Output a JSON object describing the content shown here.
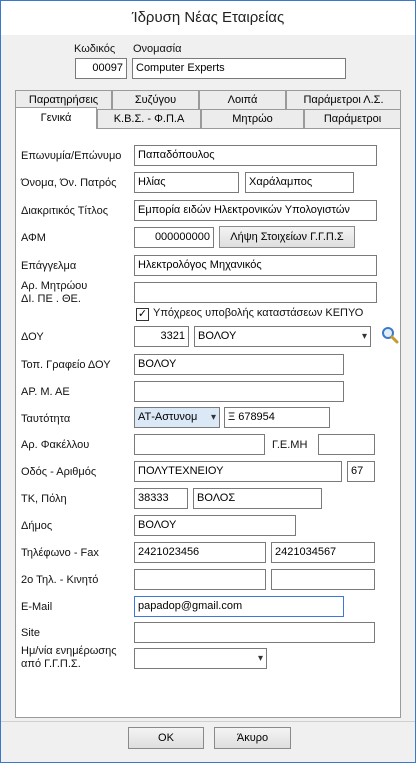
{
  "window": {
    "title": "Ίδρυση Νέας Εταιρείας"
  },
  "header": {
    "code_label": "Κωδικός",
    "name_label": "Ονομασία",
    "code_value": "00097",
    "name_value": "Computer Experts"
  },
  "tabs_row1": [
    "Παρατηρήσεις",
    "Συζύγου",
    "Λοιπά",
    "Παράμετροι Λ.Σ."
  ],
  "tabs_row2": [
    "Γενικά",
    "Κ.Β.Σ. - Φ.Π.Α",
    "Μητρώο",
    "Παράμετροι"
  ],
  "form": {
    "surname_label": "Επωνυμία/Επώνυμο",
    "surname_value": "Παπαδόπουλος",
    "name_label": "Όνομα, Όν. Πατρός",
    "first_name_value": "Ηλίας",
    "father_name_value": "Χαράλαμπος",
    "trade_label": "Διακριτικός Τίτλος",
    "trade_value": "Εμπορία ειδών Ηλεκτρονικών Υπολογιστών",
    "afm_label": "ΑΦΜ",
    "afm_value": "000000000",
    "afm_button": "Λήψη Στοιχείων Γ.Γ.Π.Σ",
    "profession_label": "Επάγγελμα",
    "profession_value": "Ηλεκτρολόγος Μηχανικός",
    "registry_label_1": "Αρ. Μητρώου",
    "registry_label_2": "ΔΙ. ΠΕ . ΘΕ.",
    "registry_value": "",
    "kepyo_label": "Υπόχρεος υποβολής καταστάσεων ΚΕΠΥΟ",
    "kepyo_checked": true,
    "doy_label": "ΔΟΥ",
    "doy_code": "3321",
    "doy_name": "ΒΟΛΟΥ",
    "doy_office_label": "Τοπ. Γραφείο ΔΟΥ",
    "doy_office_value": "ΒΟΛΟΥ",
    "ae_label": "ΑΡ. Μ. ΑΕ",
    "ae_value": "",
    "id_label": "Ταυτότητα",
    "id_type": "ΑΤ-Αστυνομ",
    "id_number": "Ξ 678954",
    "folder_label": "Αρ. Φακέλλου",
    "folder_value": "",
    "gemi_label": "Γ.Ε.ΜΗ",
    "gemi_value": "",
    "street_label": "Οδός - Αριθμός",
    "street_value": "ΠΟΛΥΤΕΧΝΕΙΟΥ",
    "street_number": "67",
    "zip_label": "ΤΚ, Πόλη",
    "zip_value": "38333",
    "city_value": "ΒΟΛΟΣ",
    "municipality_label": "Δήμος",
    "municipality_value": "ΒΟΛΟΥ",
    "phone_label": "Τηλέφωνο - Fax",
    "phone_value": "2421023456",
    "fax_value": "2421034567",
    "phone2_label": "2ο Τηλ. - Κινητό",
    "phone2_value": "",
    "mobile_value": "",
    "email_label": "E-Mail",
    "email_value": "papadop@gmail.com",
    "site_label": "Site",
    "site_value": "",
    "update_label_1": "Ημ/νία ενημέρωσης",
    "update_label_2": "από Γ.Γ.Π.Σ.",
    "update_value": ""
  },
  "footer": {
    "ok_label": "OK",
    "cancel_label": "Άκυρο"
  }
}
